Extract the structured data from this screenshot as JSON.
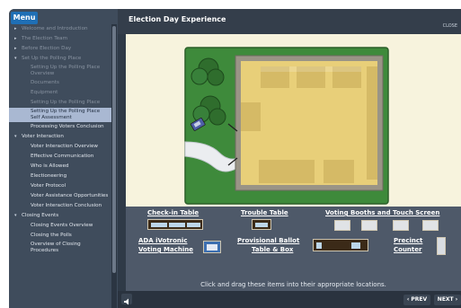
{
  "menu": {
    "tab_label": "Menu",
    "items": [
      {
        "label": "Welcome and Introduction",
        "level": 1,
        "arrow": "▸",
        "state": "dim"
      },
      {
        "label": "The Election Team",
        "level": 1,
        "arrow": "▸",
        "state": "dim"
      },
      {
        "label": "Before Election Day",
        "level": 1,
        "arrow": "▸",
        "state": "dim"
      },
      {
        "label": "Set Up the Polling Place",
        "level": 1,
        "arrow": "▾",
        "state": "dim"
      },
      {
        "label": "Setting Up the Polling Place Overview",
        "level": 2,
        "arrow": "",
        "state": "dim"
      },
      {
        "label": "Documents",
        "level": 2,
        "arrow": "",
        "state": "dim"
      },
      {
        "label": "Equipment",
        "level": 2,
        "arrow": "",
        "state": "dim"
      },
      {
        "label": "Setting Up the Polling Place",
        "level": 2,
        "arrow": "",
        "state": "dim"
      },
      {
        "label": "Setting Up the Polling Place Self Assessment",
        "level": 2,
        "arrow": "",
        "state": "selected"
      },
      {
        "label": "Processing Voters Conclusion",
        "level": 2,
        "arrow": "",
        "state": "normal"
      },
      {
        "label": "Voter Interaction",
        "level": 1,
        "arrow": "▾",
        "state": "normal"
      },
      {
        "label": "Voter Interaction Overview",
        "level": 2,
        "arrow": "",
        "state": "normal"
      },
      {
        "label": "Effective Communication",
        "level": 2,
        "arrow": "",
        "state": "normal"
      },
      {
        "label": "Who is Allowed",
        "level": 2,
        "arrow": "",
        "state": "normal"
      },
      {
        "label": "Electioneering",
        "level": 2,
        "arrow": "",
        "state": "normal"
      },
      {
        "label": "Voter Protocol",
        "level": 2,
        "arrow": "",
        "state": "normal"
      },
      {
        "label": "Voter Assistance Opportunities",
        "level": 2,
        "arrow": "",
        "state": "normal"
      },
      {
        "label": "Voter Interaction Conclusion",
        "level": 2,
        "arrow": "",
        "state": "normal"
      },
      {
        "label": "Closing Events",
        "level": 1,
        "arrow": "▾",
        "state": "normal"
      },
      {
        "label": "Closing Events Overview",
        "level": 2,
        "arrow": "",
        "state": "normal"
      },
      {
        "label": "Closing the Polls",
        "level": 2,
        "arrow": "",
        "state": "normal"
      },
      {
        "label": "Overview of Closing Procedures",
        "level": 2,
        "arrow": "",
        "state": "normal"
      }
    ]
  },
  "header": {
    "title": "Election Day Experience",
    "close_label": "CLOSE"
  },
  "palette": {
    "items": {
      "checkin_label": "Check-in Table",
      "trouble_label": "Trouble Table",
      "booths_label": "Voting Booths and Touch Screen",
      "ada_label_1": "ADA iVotronic",
      "ada_label_2": "Voting Machine",
      "provisional_label_1": "Provisional Ballot",
      "provisional_label_2": "Table & Box",
      "precinct_label_1": "Precinct",
      "precinct_label_2": "Counter"
    },
    "instruction": "Click and drag these items into their appropriate locations."
  },
  "nav": {
    "prev_label": "‹ PREV",
    "next_label": "NEXT ›"
  },
  "icons": {
    "audio": "speaker-icon",
    "menu_arrow_collapsed": "triangle-right-icon",
    "menu_arrow_expanded": "triangle-down-icon"
  },
  "colors": {
    "menu_tab": "#1f6fb5",
    "selected_item": "#a9b8d2",
    "grass": "#3e8a3b",
    "building_floor": "#e8cf79",
    "palette_bg": "#4e5969"
  }
}
